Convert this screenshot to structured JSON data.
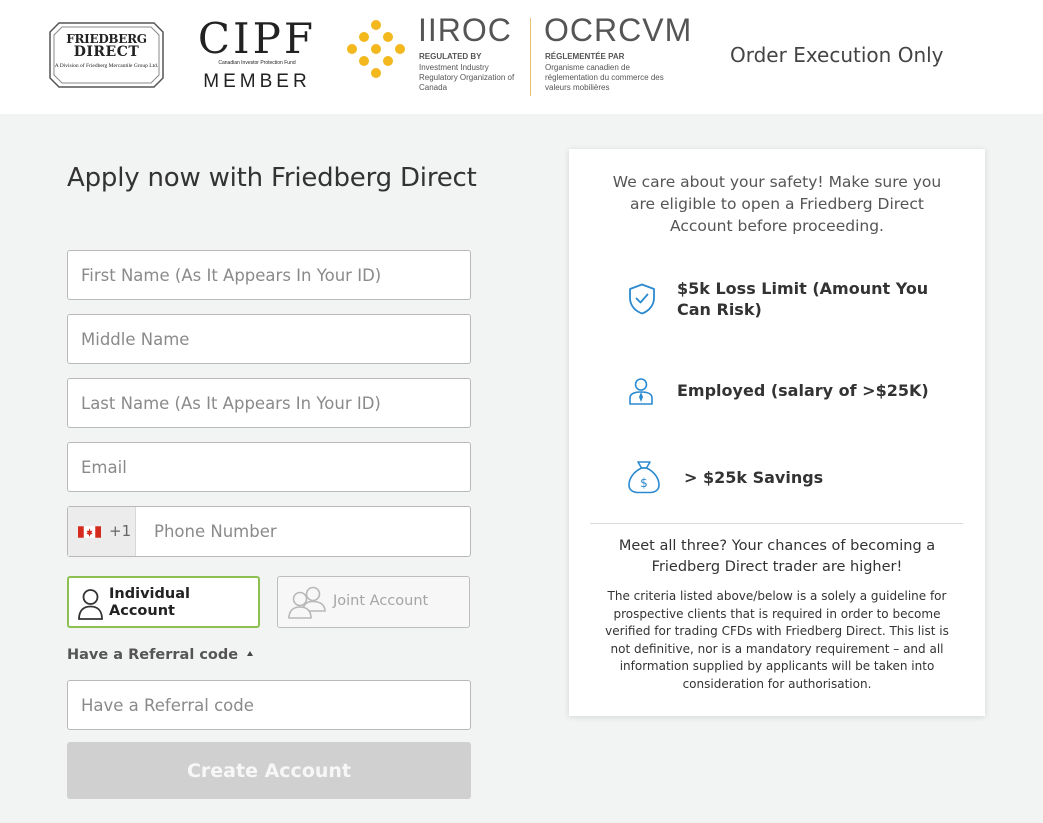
{
  "header": {
    "fd_logo": {
      "line1": "FRIEDBERG",
      "line2": "DIRECT",
      "line3": "A Division of Friedberg Mercantile Group Ltd."
    },
    "cipf_logo": {
      "name": "CIPF",
      "sub": "Canadian Investor Protection Fund",
      "member": "MEMBER"
    },
    "iiroc_logo": {
      "name": "IIROC",
      "regulated": "REGULATED BY",
      "desc": "Investment Industry Regulatory Organization of Canada",
      "fr_name": "OCRCVM",
      "fr_regulated": "RÉGLEMENTÉE PAR",
      "fr_desc": "Organisme canadien de réglementation du commerce des valeurs mobilières",
      "dot_color": "#f2b81e"
    },
    "order_execution": "Order Execution Only"
  },
  "form": {
    "title": "Apply now with Friedberg Direct",
    "first_name_placeholder": "First Name (As It Appears In Your ID)",
    "middle_name_placeholder": "Middle Name",
    "last_name_placeholder": "Last Name (As It Appears In Your ID)",
    "email_placeholder": "Email",
    "phone": {
      "country_code": "+1",
      "flag": "canada-flag",
      "placeholder": "Phone Number"
    },
    "account_types": {
      "individual": "Individual Account",
      "joint": "Joint Account",
      "selected": "individual",
      "selected_color": "#8cc152"
    },
    "referral_toggle": "Have a Referral code",
    "referral_placeholder": "Have a Referral code",
    "create_button": "Create Account"
  },
  "card": {
    "intro": "We care about your safety! Make sure you are eligible to open a Friedberg Direct Account before proceeding.",
    "criteria": [
      {
        "icon": "shield-check-icon",
        "text": "$5k Loss Limit (Amount You Can Risk)"
      },
      {
        "icon": "employee-icon",
        "text": "Employed (salary of >$25K)"
      },
      {
        "icon": "money-bag-icon",
        "text": "> $25k Savings"
      }
    ],
    "icon_color": "#2b8ad0",
    "meet": "Meet all three? Your chances of becoming a Friedberg Direct trader are higher!",
    "note": "The criteria listed above/below is a solely a guideline for prospective clients that is required in order to become verified for trading CFDs with Friedberg Direct. This list is not definitive, nor is a mandatory requirement – and all information supplied by applicants will be taken into consideration for authorisation."
  }
}
